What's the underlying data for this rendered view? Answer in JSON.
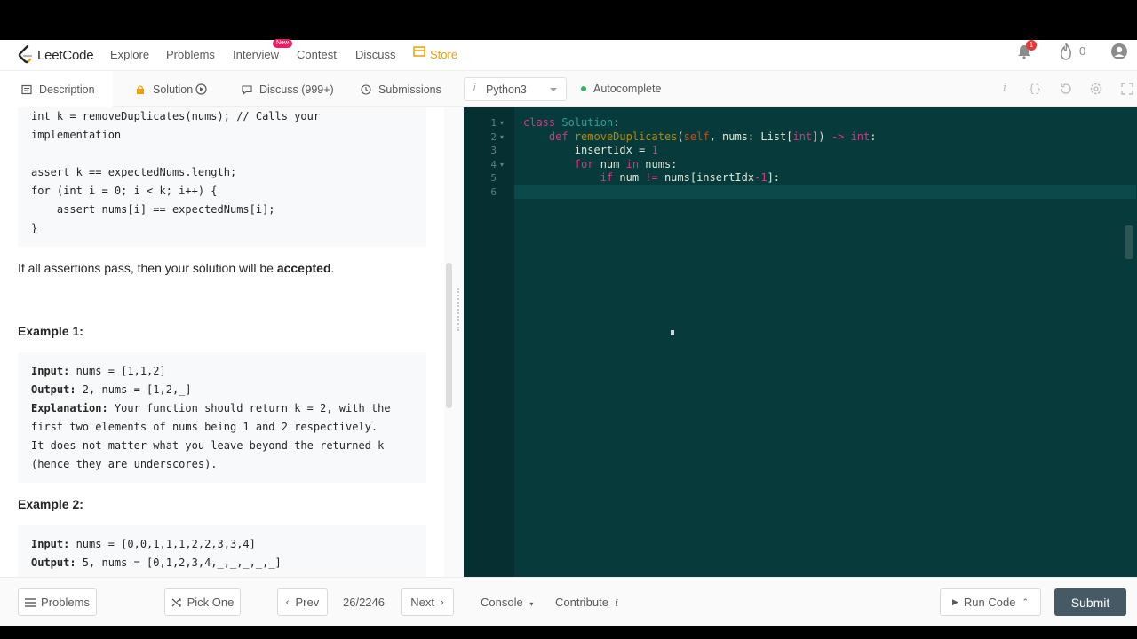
{
  "nav": {
    "logo_text": "LeetCode",
    "items": [
      "Explore",
      "Problems",
      "Interview",
      "Contest",
      "Discuss",
      "Store"
    ],
    "new_badge": "New",
    "notification_count": "1",
    "streak_count": "0"
  },
  "tabs": {
    "description": "Description",
    "solution": "Solution",
    "discuss": "Discuss (999+)",
    "submissions": "Submissions"
  },
  "editor_toolbar": {
    "language": "Python3",
    "autocomplete": "Autocomplete"
  },
  "description": {
    "code_block_lines": [
      "int k = removeDuplicates(nums); // Calls your",
      "implementation",
      "",
      "assert k == expectedNums.length;",
      "for (int i = 0; i < k; i++) {",
      "    assert nums[i] == expectedNums[i];",
      "}"
    ],
    "assert_text_pre": "If all assertions pass, then your solution will be ",
    "assert_text_bold": "accepted",
    "assert_text_post": ".",
    "example1_title": "Example 1:",
    "example1": {
      "input_label": "Input:",
      "input_value": " nums = [1,1,2]",
      "output_label": "Output:",
      "output_value": " 2, nums = [1,2,_]",
      "explanation_label": "Explanation:",
      "explanation_lines": [
        " Your function should return k = 2, with the",
        "first two elements of nums being 1 and 2 respectively.",
        "It does not matter what you leave beyond the returned k",
        "(hence they are underscores)."
      ]
    },
    "example2_title": "Example 2:",
    "example2": {
      "input_label": "Input:",
      "input_value": " nums = [0,0,1,1,1,2,2,3,3,4]",
      "output_label": "Output:",
      "output_value": " 5, nums = [0,1,2,3,4,_,_,_,_,_]"
    }
  },
  "editor": {
    "line_numbers": [
      "1",
      "2",
      "3",
      "4",
      "5",
      "6"
    ],
    "code": {
      "l1_kw": "class",
      "l1_name": " Solution",
      "l1_rest": ":",
      "l2_indent": "    ",
      "l2_kw": "def",
      "l2_fn": " removeDuplicates",
      "l2_open": "(",
      "l2_self": "self",
      "l2_mid": ", nums: List[",
      "l2_type": "int",
      "l2_close": "]) ",
      "l2_arrow": "->",
      "l2_sp": " ",
      "l2_ret": "int",
      "l2_end": ":",
      "l3_indent": "        ",
      "l3_var": "insertIdx",
      "l3_eq": " = ",
      "l3_num": "1",
      "l4_indent": "        ",
      "l4_kw": "for",
      "l4_mid": " num ",
      "l4_in": "in",
      "l4_rest": " nums:",
      "l5_indent": "            ",
      "l5_kw": "if",
      "l5_mid": " num ",
      "l5_op": "!=",
      "l5_rest": " nums[insertIdx",
      "l5_minus": "-",
      "l5_num": "1",
      "l5_end": "]:"
    }
  },
  "footer": {
    "problems": "Problems",
    "pick_one": "Pick One",
    "prev": "Prev",
    "counter": "26/2246",
    "next": "Next",
    "console": "Console",
    "contribute": "Contribute",
    "run_code": "Run Code",
    "submit": "Submit"
  }
}
